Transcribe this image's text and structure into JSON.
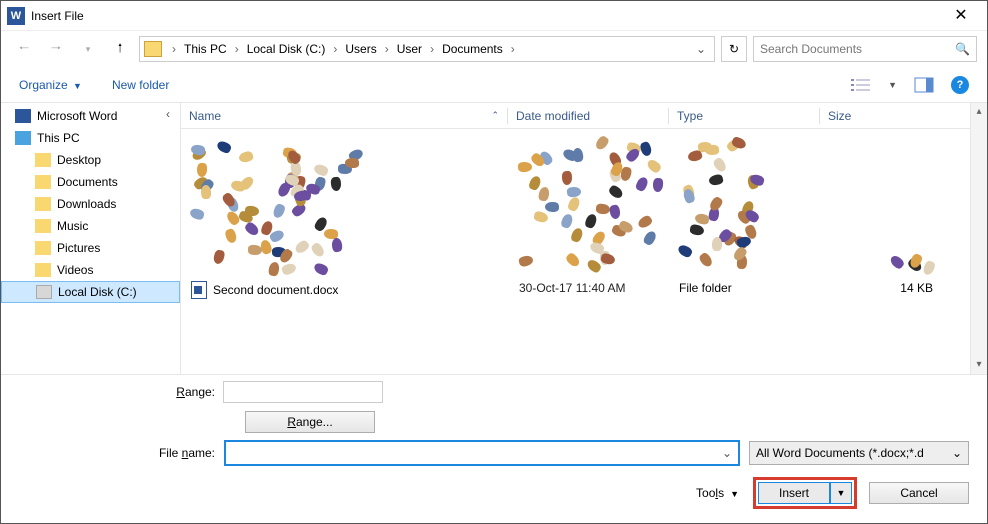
{
  "title": "Insert File",
  "breadcrumbs": [
    "This PC",
    "Local Disk (C:)",
    "Users",
    "User",
    "Documents"
  ],
  "search_placeholder": "Search Documents",
  "org": {
    "organize": "Organize",
    "newfolder": "New folder"
  },
  "columns": {
    "name": "Name",
    "date": "Date modified",
    "type": "Type",
    "size": "Size"
  },
  "tree": {
    "word": "Microsoft Word",
    "pc": "This PC",
    "desktop": "Desktop",
    "documents": "Documents",
    "downloads": "Downloads",
    "music": "Music",
    "pictures": "Pictures",
    "videos": "Videos",
    "disk": "Local Disk (C:)"
  },
  "file": {
    "name": "Second document.docx",
    "date": "30-Oct-17 11:40 AM",
    "type": "File folder",
    "size": "14 KB"
  },
  "bottom": {
    "range_label": "Range:",
    "range_btn": "Range...",
    "filename_label": "File name:",
    "filename_value": "",
    "filter": "All Word Documents (*.docx;*.d",
    "tools": "Tools",
    "insert": "Insert",
    "cancel": "Cancel"
  }
}
